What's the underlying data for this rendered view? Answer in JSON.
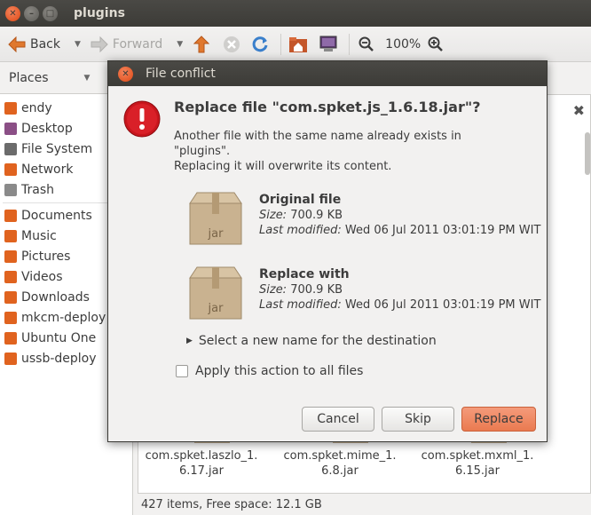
{
  "window": {
    "title": "plugins"
  },
  "toolbar": {
    "back_label": "Back",
    "forward_label": "Forward",
    "zoom_label": "100%"
  },
  "places": {
    "header": "Places",
    "items": [
      {
        "label": "endy",
        "icon": "home-folder-icon",
        "color": "#e0631f"
      },
      {
        "label": "Desktop",
        "icon": "desktop-icon",
        "color": "#8b4f86"
      },
      {
        "label": "File System",
        "icon": "harddisk-icon",
        "color": "#6b6b6b"
      },
      {
        "label": "Network",
        "icon": "network-icon",
        "color": "#e0631f"
      },
      {
        "label": "Trash",
        "icon": "trash-icon",
        "color": "#8a8a8a"
      },
      {
        "label": "Documents",
        "icon": "folder-icon",
        "color": "#e0631f"
      },
      {
        "label": "Music",
        "icon": "music-folder-icon",
        "color": "#e0631f"
      },
      {
        "label": "Pictures",
        "icon": "pictures-folder-icon",
        "color": "#e0631f"
      },
      {
        "label": "Videos",
        "icon": "videos-folder-icon",
        "color": "#e0631f"
      },
      {
        "label": "Downloads",
        "icon": "downloads-folder-icon",
        "color": "#e0631f"
      },
      {
        "label": "mkcm-deploy",
        "icon": "folder-icon",
        "color": "#e0631f"
      },
      {
        "label": "Ubuntu One",
        "icon": "folder-icon",
        "color": "#e0631f"
      },
      {
        "label": "ussb-deploy",
        "icon": "folder-icon",
        "color": "#e0631f"
      }
    ]
  },
  "files": [
    {
      "line1": "com.spket.laszlo_1.",
      "line2": "6.17.jar"
    },
    {
      "line1": "com.spket.mime_1.",
      "line2": "6.8.jar"
    },
    {
      "line1": "com.spket.mxml_1.",
      "line2": "6.15.jar"
    }
  ],
  "status": {
    "text": "427 items, Free space: 12.1 GB"
  },
  "dialog": {
    "title": "File conflict",
    "heading": "Replace file \"com.spket.js_1.6.18.jar\"?",
    "message_line1": "Another file with the same name already exists in",
    "message_line2": "\"plugins\".",
    "message_line3": "Replacing it will overwrite its content.",
    "original": {
      "title": "Original file",
      "size_label": "Size:",
      "size": "700.9 KB",
      "modified_label": "Last modified:",
      "modified": "Wed 06 Jul 2011 03:01:19 PM WIT",
      "icon_text": "jar"
    },
    "replacement": {
      "title": "Replace with",
      "size_label": "Size:",
      "size": "700.9 KB",
      "modified_label": "Last modified:",
      "modified": "Wed 06 Jul 2011 03:01:19 PM WIT",
      "icon_text": "jar"
    },
    "expander_label": "Select a new name for the destination",
    "apply_all_label": "Apply this action to all files",
    "apply_all_checked": false,
    "cancel_label": "Cancel",
    "skip_label": "Skip",
    "replace_label": "Replace"
  }
}
